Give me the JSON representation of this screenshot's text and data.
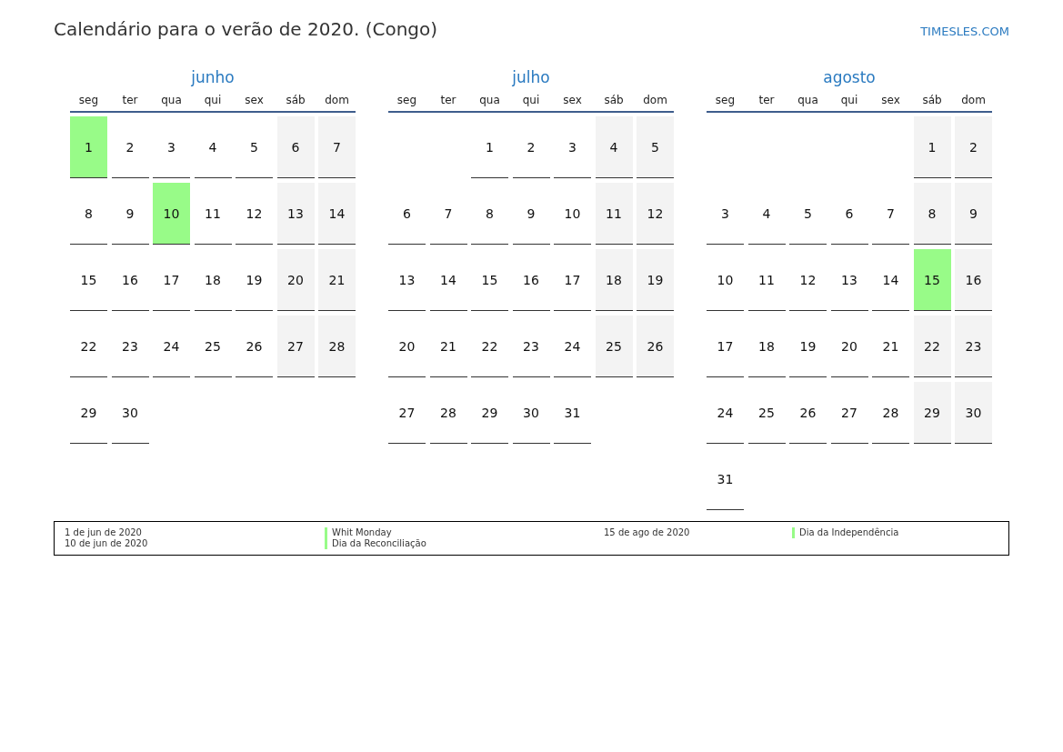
{
  "title": "Calendário para o verão de 2020. (Congo)",
  "site": "TIMESLES.COM",
  "months": [
    {
      "name": "junho",
      "weekdays": [
        "seg",
        "ter",
        "qua",
        "qui",
        "sex",
        "sáb",
        "dom"
      ],
      "weeks": [
        {
          "days": [
            {
              "day": "1",
              "holiday": true,
              "weekend": false
            },
            {
              "day": "2",
              "holiday": false,
              "weekend": false
            },
            {
              "day": "3",
              "holiday": false,
              "weekend": false
            },
            {
              "day": "4",
              "holiday": false,
              "weekend": false
            },
            {
              "day": "5",
              "holiday": false,
              "weekend": false
            },
            {
              "day": "6",
              "holiday": false,
              "weekend": true
            },
            {
              "day": "7",
              "holiday": false,
              "weekend": true
            }
          ]
        },
        {
          "days": [
            {
              "day": "8",
              "holiday": false,
              "weekend": false
            },
            {
              "day": "9",
              "holiday": false,
              "weekend": false
            },
            {
              "day": "10",
              "holiday": true,
              "weekend": false
            },
            {
              "day": "11",
              "holiday": false,
              "weekend": false
            },
            {
              "day": "12",
              "holiday": false,
              "weekend": false
            },
            {
              "day": "13",
              "holiday": false,
              "weekend": true
            },
            {
              "day": "14",
              "holiday": false,
              "weekend": true
            }
          ]
        },
        {
          "days": [
            {
              "day": "15",
              "holiday": false,
              "weekend": false
            },
            {
              "day": "16",
              "holiday": false,
              "weekend": false
            },
            {
              "day": "17",
              "holiday": false,
              "weekend": false
            },
            {
              "day": "18",
              "holiday": false,
              "weekend": false
            },
            {
              "day": "19",
              "holiday": false,
              "weekend": false
            },
            {
              "day": "20",
              "holiday": false,
              "weekend": true
            },
            {
              "day": "21",
              "holiday": false,
              "weekend": true
            }
          ]
        },
        {
          "days": [
            {
              "day": "22",
              "holiday": false,
              "weekend": false
            },
            {
              "day": "23",
              "holiday": false,
              "weekend": false
            },
            {
              "day": "24",
              "holiday": false,
              "weekend": false
            },
            {
              "day": "25",
              "holiday": false,
              "weekend": false
            },
            {
              "day": "26",
              "holiday": false,
              "weekend": false
            },
            {
              "day": "27",
              "holiday": false,
              "weekend": true
            },
            {
              "day": "28",
              "holiday": false,
              "weekend": true
            }
          ]
        },
        {
          "days": [
            {
              "day": "29",
              "holiday": false,
              "weekend": false
            },
            {
              "day": "30",
              "holiday": false,
              "weekend": false
            }
          ]
        }
      ]
    },
    {
      "name": "julho",
      "weekdays": [
        "seg",
        "ter",
        "qua",
        "qui",
        "sex",
        "sáb",
        "dom"
      ],
      "weeks": [
        {
          "days": [
            {
              "day": "1",
              "holiday": false,
              "weekend": false
            },
            {
              "day": "2",
              "holiday": false,
              "weekend": false
            },
            {
              "day": "3",
              "holiday": false,
              "weekend": false
            },
            {
              "day": "4",
              "holiday": false,
              "weekend": true
            },
            {
              "day": "5",
              "holiday": false,
              "weekend": true
            }
          ]
        },
        {
          "days": [
            {
              "day": "6",
              "holiday": false,
              "weekend": false
            },
            {
              "day": "7",
              "holiday": false,
              "weekend": false
            },
            {
              "day": "8",
              "holiday": false,
              "weekend": false
            },
            {
              "day": "9",
              "holiday": false,
              "weekend": false
            },
            {
              "day": "10",
              "holiday": false,
              "weekend": false
            },
            {
              "day": "11",
              "holiday": false,
              "weekend": true
            },
            {
              "day": "12",
              "holiday": false,
              "weekend": true
            }
          ]
        },
        {
          "days": [
            {
              "day": "13",
              "holiday": false,
              "weekend": false
            },
            {
              "day": "14",
              "holiday": false,
              "weekend": false
            },
            {
              "day": "15",
              "holiday": false,
              "weekend": false
            },
            {
              "day": "16",
              "holiday": false,
              "weekend": false
            },
            {
              "day": "17",
              "holiday": false,
              "weekend": false
            },
            {
              "day": "18",
              "holiday": false,
              "weekend": true
            },
            {
              "day": "19",
              "holiday": false,
              "weekend": true
            }
          ]
        },
        {
          "days": [
            {
              "day": "20",
              "holiday": false,
              "weekend": false
            },
            {
              "day": "21",
              "holiday": false,
              "weekend": false
            },
            {
              "day": "22",
              "holiday": false,
              "weekend": false
            },
            {
              "day": "23",
              "holiday": false,
              "weekend": false
            },
            {
              "day": "24",
              "holiday": false,
              "weekend": false
            },
            {
              "day": "25",
              "holiday": false,
              "weekend": true
            },
            {
              "day": "26",
              "holiday": false,
              "weekend": true
            }
          ]
        },
        {
          "days": [
            {
              "day": "27",
              "holiday": false,
              "weekend": false
            },
            {
              "day": "28",
              "holiday": false,
              "weekend": false
            },
            {
              "day": "29",
              "holiday": false,
              "weekend": false
            },
            {
              "day": "30",
              "holiday": false,
              "weekend": false
            },
            {
              "day": "31",
              "holiday": false,
              "weekend": false
            }
          ]
        }
      ]
    },
    {
      "name": "agosto",
      "weekdays": [
        "seg",
        "ter",
        "qua",
        "qui",
        "sex",
        "sáb",
        "dom"
      ],
      "weeks": [
        {
          "days": [
            {
              "day": "1",
              "holiday": false,
              "weekend": true
            },
            {
              "day": "2",
              "holiday": false,
              "weekend": true
            }
          ]
        },
        {
          "days": [
            {
              "day": "3",
              "holiday": false,
              "weekend": false
            },
            {
              "day": "4",
              "holiday": false,
              "weekend": false
            },
            {
              "day": "5",
              "holiday": false,
              "weekend": false
            },
            {
              "day": "6",
              "holiday": false,
              "weekend": false
            },
            {
              "day": "7",
              "holiday": false,
              "weekend": false
            },
            {
              "day": "8",
              "holiday": false,
              "weekend": true
            },
            {
              "day": "9",
              "holiday": false,
              "weekend": true
            }
          ]
        },
        {
          "days": [
            {
              "day": "10",
              "holiday": false,
              "weekend": false
            },
            {
              "day": "11",
              "holiday": false,
              "weekend": false
            },
            {
              "day": "12",
              "holiday": false,
              "weekend": false
            },
            {
              "day": "13",
              "holiday": false,
              "weekend": false
            },
            {
              "day": "14",
              "holiday": false,
              "weekend": false
            },
            {
              "day": "15",
              "holiday": true,
              "weekend": true
            },
            {
              "day": "16",
              "holiday": false,
              "weekend": true
            }
          ]
        },
        {
          "days": [
            {
              "day": "17",
              "holiday": false,
              "weekend": false
            },
            {
              "day": "18",
              "holiday": false,
              "weekend": false
            },
            {
              "day": "19",
              "holiday": false,
              "weekend": false
            },
            {
              "day": "20",
              "holiday": false,
              "weekend": false
            },
            {
              "day": "21",
              "holiday": false,
              "weekend": false
            },
            {
              "day": "22",
              "holiday": false,
              "weekend": true
            },
            {
              "day": "23",
              "holiday": false,
              "weekend": true
            }
          ]
        },
        {
          "days": [
            {
              "day": "24",
              "holiday": false,
              "weekend": false
            },
            {
              "day": "25",
              "holiday": false,
              "weekend": false
            },
            {
              "day": "26",
              "holiday": false,
              "weekend": false
            },
            {
              "day": "27",
              "holiday": false,
              "weekend": false
            },
            {
              "day": "28",
              "holiday": false,
              "weekend": false
            },
            {
              "day": "29",
              "holiday": false,
              "weekend": true
            },
            {
              "day": "30",
              "holiday": false,
              "weekend": true
            }
          ]
        },
        {
          "days": [
            {
              "day": "31",
              "holiday": false,
              "weekend": false
            }
          ]
        }
      ]
    }
  ],
  "legend": {
    "groups": [
      {
        "entries": [
          {
            "date": "1 de jun de 2020",
            "name": "Whit Monday"
          },
          {
            "date": "10 de jun de 2020",
            "name": "Dia da Reconciliação"
          }
        ]
      },
      {
        "entries": [
          {
            "date": "15 de ago de 2020",
            "name": "Dia da Independência"
          }
        ]
      }
    ]
  }
}
